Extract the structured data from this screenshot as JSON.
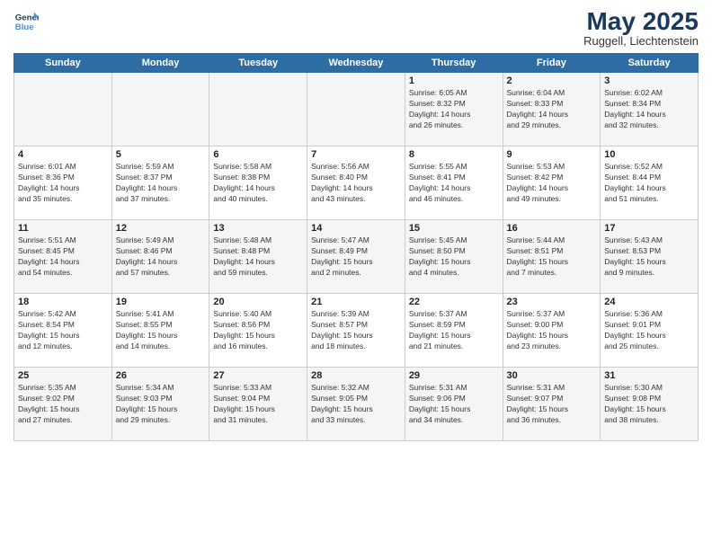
{
  "logo": {
    "line1": "General",
    "line2": "Blue"
  },
  "title": "May 2025",
  "subtitle": "Ruggell, Liechtenstein",
  "days_of_week": [
    "Sunday",
    "Monday",
    "Tuesday",
    "Wednesday",
    "Thursday",
    "Friday",
    "Saturday"
  ],
  "weeks": [
    [
      {
        "day": "",
        "info": ""
      },
      {
        "day": "",
        "info": ""
      },
      {
        "day": "",
        "info": ""
      },
      {
        "day": "",
        "info": ""
      },
      {
        "day": "1",
        "info": "Sunrise: 6:05 AM\nSunset: 8:32 PM\nDaylight: 14 hours\nand 26 minutes."
      },
      {
        "day": "2",
        "info": "Sunrise: 6:04 AM\nSunset: 8:33 PM\nDaylight: 14 hours\nand 29 minutes."
      },
      {
        "day": "3",
        "info": "Sunrise: 6:02 AM\nSunset: 8:34 PM\nDaylight: 14 hours\nand 32 minutes."
      }
    ],
    [
      {
        "day": "4",
        "info": "Sunrise: 6:01 AM\nSunset: 8:36 PM\nDaylight: 14 hours\nand 35 minutes."
      },
      {
        "day": "5",
        "info": "Sunrise: 5:59 AM\nSunset: 8:37 PM\nDaylight: 14 hours\nand 37 minutes."
      },
      {
        "day": "6",
        "info": "Sunrise: 5:58 AM\nSunset: 8:38 PM\nDaylight: 14 hours\nand 40 minutes."
      },
      {
        "day": "7",
        "info": "Sunrise: 5:56 AM\nSunset: 8:40 PM\nDaylight: 14 hours\nand 43 minutes."
      },
      {
        "day": "8",
        "info": "Sunrise: 5:55 AM\nSunset: 8:41 PM\nDaylight: 14 hours\nand 46 minutes."
      },
      {
        "day": "9",
        "info": "Sunrise: 5:53 AM\nSunset: 8:42 PM\nDaylight: 14 hours\nand 49 minutes."
      },
      {
        "day": "10",
        "info": "Sunrise: 5:52 AM\nSunset: 8:44 PM\nDaylight: 14 hours\nand 51 minutes."
      }
    ],
    [
      {
        "day": "11",
        "info": "Sunrise: 5:51 AM\nSunset: 8:45 PM\nDaylight: 14 hours\nand 54 minutes."
      },
      {
        "day": "12",
        "info": "Sunrise: 5:49 AM\nSunset: 8:46 PM\nDaylight: 14 hours\nand 57 minutes."
      },
      {
        "day": "13",
        "info": "Sunrise: 5:48 AM\nSunset: 8:48 PM\nDaylight: 14 hours\nand 59 minutes."
      },
      {
        "day": "14",
        "info": "Sunrise: 5:47 AM\nSunset: 8:49 PM\nDaylight: 15 hours\nand 2 minutes."
      },
      {
        "day": "15",
        "info": "Sunrise: 5:45 AM\nSunset: 8:50 PM\nDaylight: 15 hours\nand 4 minutes."
      },
      {
        "day": "16",
        "info": "Sunrise: 5:44 AM\nSunset: 8:51 PM\nDaylight: 15 hours\nand 7 minutes."
      },
      {
        "day": "17",
        "info": "Sunrise: 5:43 AM\nSunset: 8:53 PM\nDaylight: 15 hours\nand 9 minutes."
      }
    ],
    [
      {
        "day": "18",
        "info": "Sunrise: 5:42 AM\nSunset: 8:54 PM\nDaylight: 15 hours\nand 12 minutes."
      },
      {
        "day": "19",
        "info": "Sunrise: 5:41 AM\nSunset: 8:55 PM\nDaylight: 15 hours\nand 14 minutes."
      },
      {
        "day": "20",
        "info": "Sunrise: 5:40 AM\nSunset: 8:56 PM\nDaylight: 15 hours\nand 16 minutes."
      },
      {
        "day": "21",
        "info": "Sunrise: 5:39 AM\nSunset: 8:57 PM\nDaylight: 15 hours\nand 18 minutes."
      },
      {
        "day": "22",
        "info": "Sunrise: 5:37 AM\nSunset: 8:59 PM\nDaylight: 15 hours\nand 21 minutes."
      },
      {
        "day": "23",
        "info": "Sunrise: 5:37 AM\nSunset: 9:00 PM\nDaylight: 15 hours\nand 23 minutes."
      },
      {
        "day": "24",
        "info": "Sunrise: 5:36 AM\nSunset: 9:01 PM\nDaylight: 15 hours\nand 25 minutes."
      }
    ],
    [
      {
        "day": "25",
        "info": "Sunrise: 5:35 AM\nSunset: 9:02 PM\nDaylight: 15 hours\nand 27 minutes."
      },
      {
        "day": "26",
        "info": "Sunrise: 5:34 AM\nSunset: 9:03 PM\nDaylight: 15 hours\nand 29 minutes."
      },
      {
        "day": "27",
        "info": "Sunrise: 5:33 AM\nSunset: 9:04 PM\nDaylight: 15 hours\nand 31 minutes."
      },
      {
        "day": "28",
        "info": "Sunrise: 5:32 AM\nSunset: 9:05 PM\nDaylight: 15 hours\nand 33 minutes."
      },
      {
        "day": "29",
        "info": "Sunrise: 5:31 AM\nSunset: 9:06 PM\nDaylight: 15 hours\nand 34 minutes."
      },
      {
        "day": "30",
        "info": "Sunrise: 5:31 AM\nSunset: 9:07 PM\nDaylight: 15 hours\nand 36 minutes."
      },
      {
        "day": "31",
        "info": "Sunrise: 5:30 AM\nSunset: 9:08 PM\nDaylight: 15 hours\nand 38 minutes."
      }
    ]
  ]
}
